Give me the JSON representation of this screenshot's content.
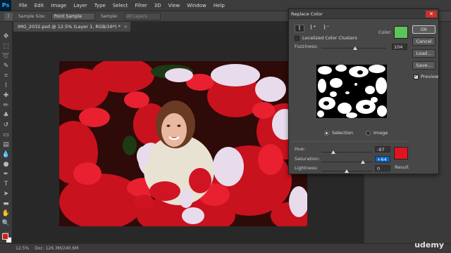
{
  "app": {
    "logo": "Ps"
  },
  "menu": [
    "File",
    "Edit",
    "Image",
    "Layer",
    "Type",
    "Select",
    "Filter",
    "3D",
    "View",
    "Window",
    "Help"
  ],
  "options_bar": {
    "sample_size_label": "Sample Size:",
    "sample_size_value": "Point Sample",
    "sample_label": "Sample:",
    "sample_value": "All Layers"
  },
  "document": {
    "tab_title": "IMG_2032.psd @ 12.5% (Layer 1, RGB/16*) *",
    "tab_close": "×"
  },
  "status": {
    "zoom": "12.5%",
    "doc_size": "Doc: 126.3M/240.6M"
  },
  "watermark": "udemy",
  "dialog": {
    "title": "Replace Color",
    "close": "✕",
    "localized_clusters_label": "Localized Color Clusters",
    "localized_clusters_checked": false,
    "color_label": "Color:",
    "selected_color": "#5dc45a",
    "fuzziness_label": "Fuzziness:",
    "fuzziness_value": "104",
    "fuzziness_level": 0.52,
    "selection_label": "Selection",
    "image_label": "Image",
    "selection_mode": "Selection",
    "hue_label": "Hue:",
    "hue_value": "-97",
    "hue_level": 0.23,
    "saturation_label": "Saturation:",
    "saturation_value": "+64",
    "saturation_level": 0.82,
    "lightness_label": "Lightness:",
    "lightness_value": "0",
    "lightness_level": 0.5,
    "result_color": "#e0141e",
    "result_label": "Result",
    "buttons": {
      "ok": "OK",
      "cancel": "Cancel",
      "load": "Load...",
      "save": "Save..."
    },
    "preview_label": "Preview",
    "preview_checked": true
  },
  "icons": {
    "eyedropper": "eyedropper-icon",
    "eyedropper_plus": "eyedropper-plus-icon",
    "eyedropper_minus": "eyedropper-minus-icon"
  }
}
